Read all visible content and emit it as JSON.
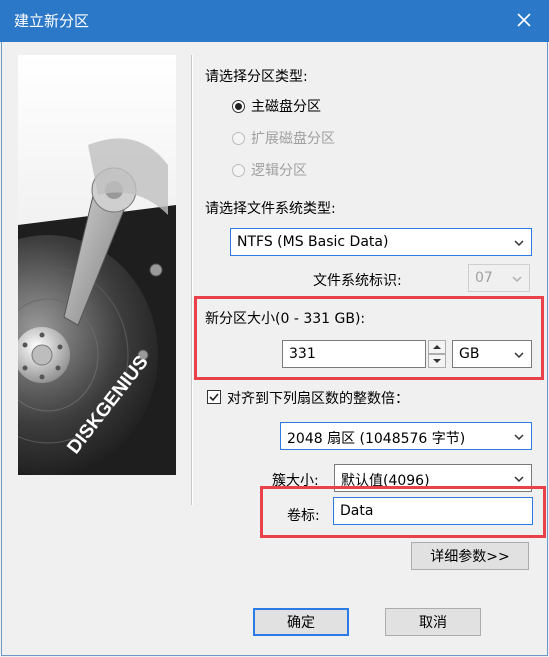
{
  "window": {
    "title": "建立新分区"
  },
  "partition_type": {
    "heading": "请选择分区类型:",
    "options": [
      {
        "label": "主磁盘分区",
        "selected": true,
        "enabled": true
      },
      {
        "label": "扩展磁盘分区",
        "selected": false,
        "enabled": false
      },
      {
        "label": "逻辑分区",
        "selected": false,
        "enabled": false
      }
    ]
  },
  "filesystem": {
    "heading": "请选择文件系统类型:",
    "selected": "NTFS (MS Basic Data)",
    "id_label": "文件系统标识:",
    "id_value": "07"
  },
  "size": {
    "label": "新分区大小(0 - 331 GB):",
    "value": "331",
    "unit": "GB"
  },
  "alignment": {
    "checkbox_label": "对齐到下列扇区数的整数倍：",
    "checked": true,
    "selected": "2048 扇区 (1048576 字节)"
  },
  "cluster": {
    "label": "簇大小:",
    "selected": "默认值(4096)"
  },
  "volume": {
    "label": "卷标:",
    "value": "Data"
  },
  "buttons": {
    "details": "详细参数>>",
    "ok": "确定",
    "cancel": "取消"
  },
  "branding": {
    "logo_text": "DISKGENIUS"
  },
  "colors": {
    "titlebar": "#2b78c8",
    "highlight": "#e8414a",
    "focus": "#2c7be5"
  }
}
